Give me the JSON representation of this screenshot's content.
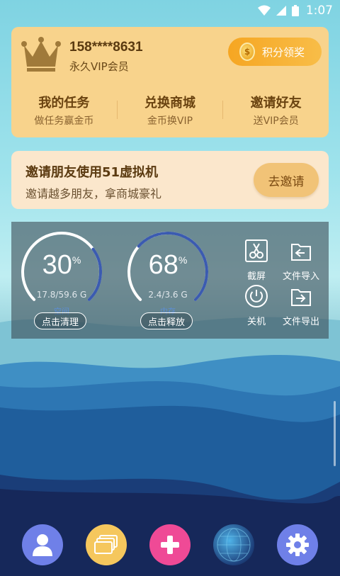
{
  "status_bar": {
    "time": "1:07",
    "icons": [
      "wifi-icon",
      "signal-icon",
      "battery-icon"
    ]
  },
  "vip_card": {
    "phone": "158****8631",
    "membership": "永久VIP会员",
    "points_button": "积分领奖",
    "actions": [
      {
        "title": "我的任务",
        "subtitle": "做任务赢金币"
      },
      {
        "title": "兑换商城",
        "subtitle": "金币换VIP"
      },
      {
        "title": "邀请好友",
        "subtitle": "送VIP会员"
      }
    ]
  },
  "invite_card": {
    "title": "邀请朋友使用51虚拟机",
    "subtitle": "邀请越多朋友，拿商城豪礼",
    "button": "去邀请"
  },
  "panel": {
    "storage": {
      "percent": "30",
      "unit": "%",
      "size": "17.8/59.6 G",
      "kind": "空间",
      "button": "点击清理",
      "fraction": 0.3
    },
    "memory": {
      "percent": "68",
      "unit": "%",
      "size": "2.4/3.6 G",
      "kind": "内存",
      "button": "点击释放",
      "fraction": 0.68
    },
    "tools": [
      {
        "label": "截屏",
        "icon": "scissors-icon"
      },
      {
        "label": "文件导入",
        "icon": "folder-import-icon"
      },
      {
        "label": "关机",
        "icon": "power-icon"
      },
      {
        "label": "文件导出",
        "icon": "folder-export-icon"
      }
    ]
  },
  "bottom_nav": [
    "user-icon",
    "windows-icon",
    "add-icon",
    "globe-icon",
    "settings-icon"
  ],
  "colors": {
    "vip_card": "#f8d38c",
    "invite_card": "#fbe7cc",
    "points_button": "#f6a622",
    "gauge_track": "#ffffff",
    "gauge_fill": "#3b5bb0",
    "nav_user": "#6f80e8",
    "nav_windows": "#f5c75d",
    "nav_add": "#ef4a96",
    "nav_settings": "#6f80e8"
  }
}
